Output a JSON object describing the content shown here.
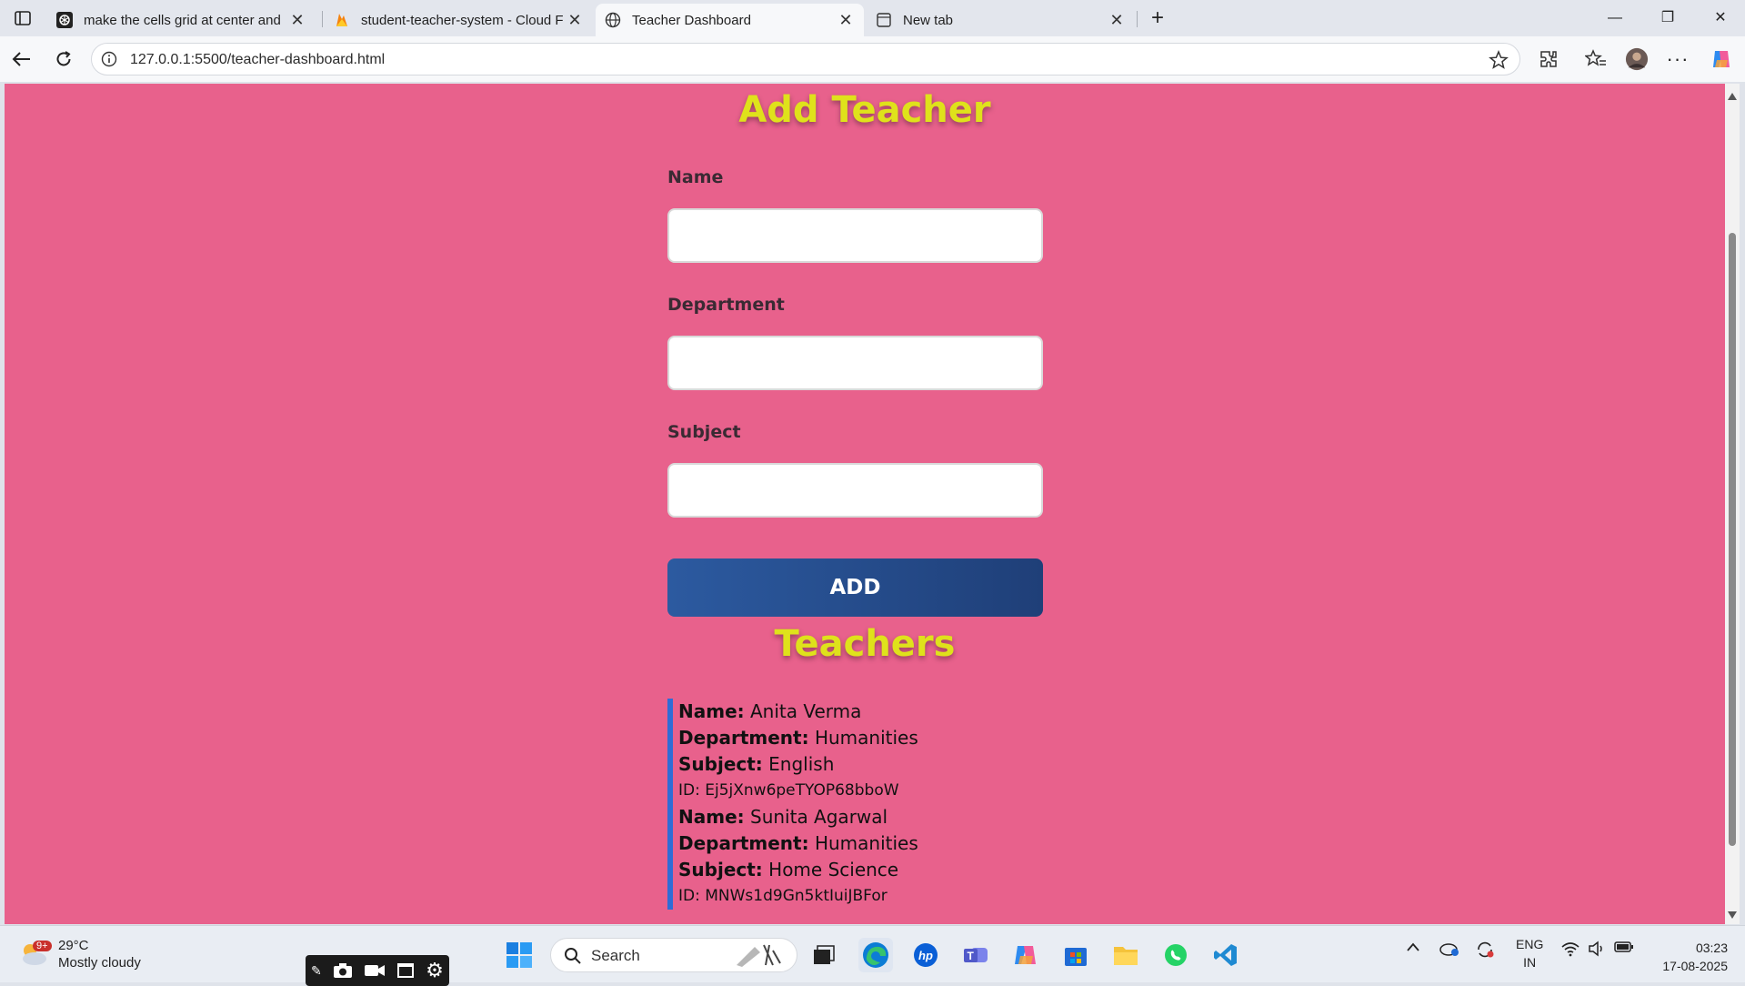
{
  "browser": {
    "tabs": [
      {
        "title": "make the cells grid at center and",
        "active": false
      },
      {
        "title": "student-teacher-system - Cloud F",
        "active": false
      },
      {
        "title": "Teacher Dashboard",
        "active": true
      },
      {
        "title": "New tab",
        "active": false
      }
    ],
    "url": "127.0.0.1:5500/teacher-dashboard.html"
  },
  "form": {
    "heading": "Add Teacher",
    "name_label": "Name",
    "name_value": "",
    "department_label": "Department",
    "department_value": "",
    "subject_label": "Subject",
    "subject_value": "",
    "add_button": "ADD"
  },
  "teachers": {
    "heading": "Teachers",
    "name_key": "Name:",
    "department_key": "Department:",
    "subject_key": "Subject:",
    "items": [
      {
        "name": "Anita Verma",
        "department": "Humanities",
        "subject": "English",
        "id": "ID: Ej5jXnw6peTYOP68bboW"
      },
      {
        "name": "Sunita Agarwal",
        "department": "Humanities",
        "subject": "Home Science",
        "id": "ID: MNWs1d9Gn5ktIuiJBFor"
      }
    ]
  },
  "taskbar": {
    "weather_badge": "9+",
    "temperature": "29°C",
    "condition": "Mostly cloudy",
    "search_placeholder": "Search",
    "language": "ENG",
    "region": "IN",
    "time": "03:23",
    "date": "17-08-2025"
  },
  "colors": {
    "page_bg": "#e8618c",
    "heading": "#dfe21b",
    "button": "#2c5aa0",
    "list_border": "#2f6cd6"
  }
}
